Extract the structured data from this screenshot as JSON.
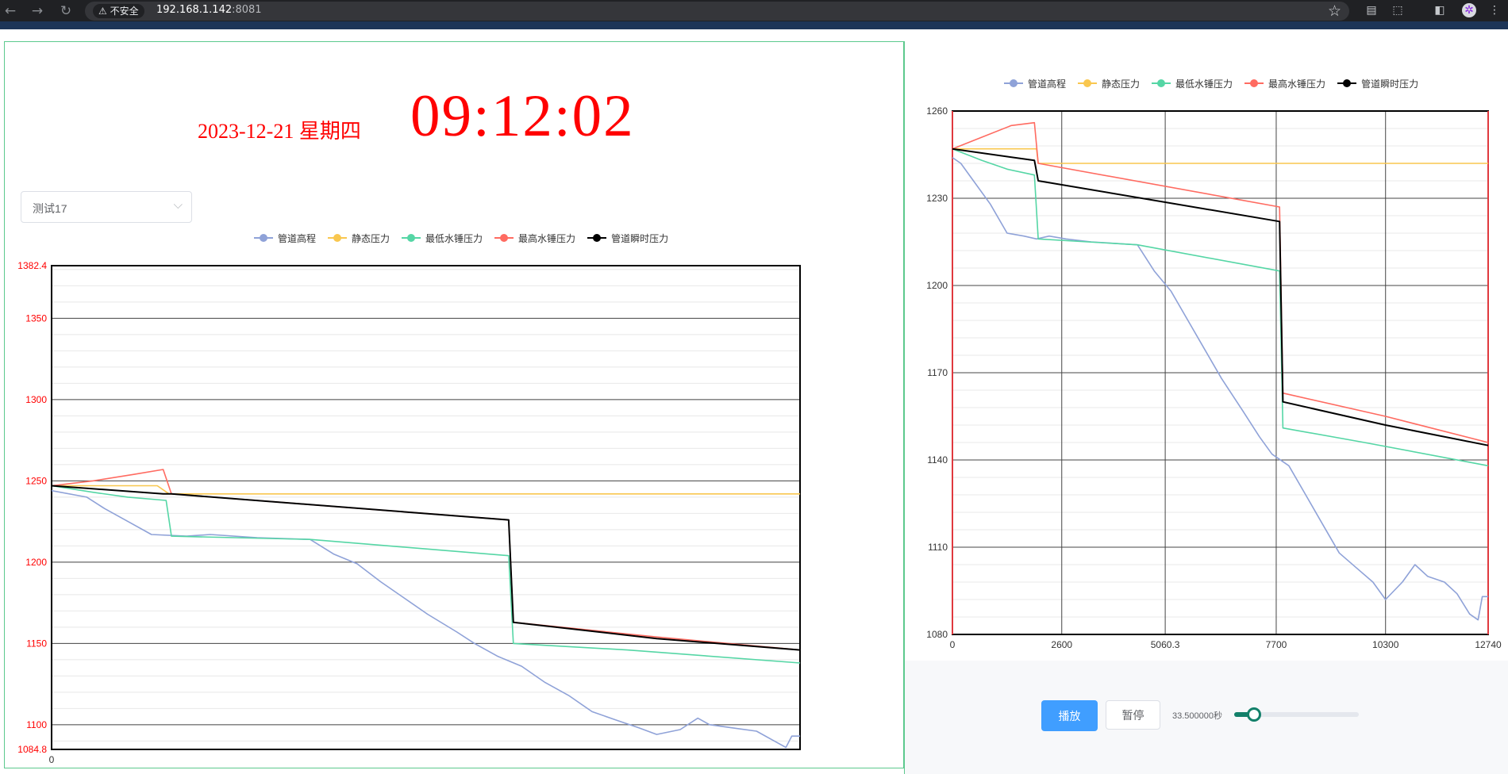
{
  "browser": {
    "security_label": "不安全",
    "url_host": "192.168.1.142",
    "url_port": ":8081"
  },
  "header": {
    "date": "2023-12-21 星期四",
    "time": "09:12:02"
  },
  "select": {
    "value": "测试17"
  },
  "legend": [
    {
      "name": "管道高程",
      "color": "#8fa2d8"
    },
    {
      "name": "静态压力",
      "color": "#f9c74f"
    },
    {
      "name": "最低水锤压力",
      "color": "#55d6a5"
    },
    {
      "name": "最高水锤压力",
      "color": "#ff6b61"
    },
    {
      "name": "管道瞬时压力",
      "color": "#000000"
    }
  ],
  "controls": {
    "play": "播放",
    "pause": "暂停",
    "speed": "33.500000秒",
    "progress": 0.16
  },
  "chart_data": [
    {
      "type": "line",
      "title": "",
      "xlabel": "",
      "ylabel": "",
      "xlim": [
        0,
        12740
      ],
      "ylim": [
        1084.8,
        1382.4
      ],
      "yticks": [
        "1382.4",
        "1350",
        "1300",
        "1250",
        "1200",
        "1150",
        "1100",
        "1084.8"
      ],
      "xticks": [
        "0"
      ],
      "grid": true,
      "legend_position": "top",
      "series": [
        {
          "name": "管道高程",
          "color": "#8fa2d8",
          "values": [
            [
              0,
              1244
            ],
            [
              600,
              1240
            ],
            [
              900,
              1233
            ],
            [
              1300,
              1225
            ],
            [
              1700,
              1217
            ],
            [
              2300,
              1216
            ],
            [
              2700,
              1217
            ],
            [
              3500,
              1215
            ],
            [
              4400,
              1214
            ],
            [
              4800,
              1205
            ],
            [
              5200,
              1199
            ],
            [
              5600,
              1188
            ],
            [
              6000,
              1178
            ],
            [
              6400,
              1168
            ],
            [
              6900,
              1157
            ],
            [
              7200,
              1150
            ],
            [
              7600,
              1142
            ],
            [
              8000,
              1136
            ],
            [
              8400,
              1126
            ],
            [
              8800,
              1118
            ],
            [
              9200,
              1108
            ],
            [
              9600,
              1103
            ],
            [
              10000,
              1098
            ],
            [
              10300,
              1094
            ],
            [
              10700,
              1097
            ],
            [
              11000,
              1104
            ],
            [
              11200,
              1100
            ],
            [
              11600,
              1098
            ],
            [
              12000,
              1096
            ],
            [
              12300,
              1090
            ],
            [
              12500,
              1086
            ],
            [
              12600,
              1093
            ],
            [
              12740,
              1093
            ]
          ]
        },
        {
          "name": "静态压力",
          "color": "#f9c74f",
          "values": [
            [
              0,
              1247
            ],
            [
              1800,
              1247
            ],
            [
              2000,
              1242
            ],
            [
              12740,
              1242
            ]
          ]
        },
        {
          "name": "最低水锤压力",
          "color": "#55d6a5",
          "values": [
            [
              0,
              1247
            ],
            [
              700,
              1243
            ],
            [
              1300,
              1240
            ],
            [
              1950,
              1238
            ],
            [
              2040,
              1216
            ],
            [
              4400,
              1214
            ],
            [
              7780,
              1204
            ],
            [
              7860,
              1150
            ],
            [
              9800,
              1146
            ],
            [
              12740,
              1138
            ]
          ]
        },
        {
          "name": "最高水锤压力",
          "color": "#ff6b61",
          "values": [
            [
              0,
              1247
            ],
            [
              700,
              1250
            ],
            [
              1400,
              1254
            ],
            [
              1900,
              1257
            ],
            [
              2040,
              1242
            ],
            [
              7780,
              1226
            ],
            [
              7860,
              1163
            ],
            [
              10300,
              1154
            ],
            [
              12740,
              1146
            ]
          ]
        },
        {
          "name": "管道瞬时压力",
          "color": "#000000",
          "values": [
            [
              0,
              1247
            ],
            [
              1900,
              1242
            ],
            [
              2040,
              1242
            ],
            [
              7780,
              1226
            ],
            [
              7860,
              1163
            ],
            [
              10300,
              1153
            ],
            [
              12740,
              1146
            ]
          ]
        }
      ]
    },
    {
      "type": "line",
      "title": "",
      "xlabel": "",
      "ylabel": "",
      "xlim": [
        0,
        12740
      ],
      "ylim": [
        1080,
        1260
      ],
      "xticks": [
        "0",
        "2600",
        "5060.3",
        "7700",
        "10300",
        "12740"
      ],
      "yticks": [
        "1260",
        "1230",
        "1200",
        "1170",
        "1140",
        "1110",
        "1080"
      ],
      "grid": true,
      "legend_position": "top",
      "series": [
        {
          "name": "管道高程",
          "color": "#8fa2d8",
          "values": [
            [
              0,
              1244
            ],
            [
              200,
              1242
            ],
            [
              500,
              1236
            ],
            [
              900,
              1228
            ],
            [
              1300,
              1218
            ],
            [
              1700,
              1217
            ],
            [
              2000,
              1216
            ],
            [
              2300,
              1217
            ],
            [
              2700,
              1216
            ],
            [
              3300,
              1215
            ],
            [
              4400,
              1214
            ],
            [
              4800,
              1205
            ],
            [
              5200,
              1198
            ],
            [
              5600,
              1188
            ],
            [
              6000,
              1178
            ],
            [
              6400,
              1168
            ],
            [
              6900,
              1157
            ],
            [
              7300,
              1148
            ],
            [
              7600,
              1142
            ],
            [
              8000,
              1138
            ],
            [
              8400,
              1128
            ],
            [
              8800,
              1118
            ],
            [
              9200,
              1108
            ],
            [
              9600,
              1103
            ],
            [
              10000,
              1098
            ],
            [
              10300,
              1092
            ],
            [
              10700,
              1098
            ],
            [
              11000,
              1104
            ],
            [
              11300,
              1100
            ],
            [
              11700,
              1098
            ],
            [
              12000,
              1094
            ],
            [
              12300,
              1087
            ],
            [
              12500,
              1085
            ],
            [
              12600,
              1093
            ],
            [
              12740,
              1093
            ]
          ]
        },
        {
          "name": "静态压力",
          "color": "#f9c74f",
          "values": [
            [
              0,
              1247
            ],
            [
              2000,
              1247
            ],
            [
              2040,
              1242
            ],
            [
              12740,
              1242
            ]
          ]
        },
        {
          "name": "最低水锤压力",
          "color": "#55d6a5",
          "values": [
            [
              0,
              1247
            ],
            [
              700,
              1243
            ],
            [
              1300,
              1240
            ],
            [
              1950,
              1238
            ],
            [
              2040,
              1216
            ],
            [
              4400,
              1214
            ],
            [
              7780,
              1205
            ],
            [
              7860,
              1151
            ],
            [
              9800,
              1146
            ],
            [
              12740,
              1138
            ]
          ]
        },
        {
          "name": "最高水锤压力",
          "color": "#ff6b61",
          "values": [
            [
              0,
              1247
            ],
            [
              700,
              1251
            ],
            [
              1400,
              1255
            ],
            [
              1950,
              1256
            ],
            [
              2040,
              1242
            ],
            [
              7780,
              1227
            ],
            [
              7860,
              1163
            ],
            [
              10300,
              1155
            ],
            [
              12740,
              1146
            ]
          ]
        },
        {
          "name": "管道瞬时压力",
          "color": "#000000",
          "values": [
            [
              0,
              1247
            ],
            [
              1950,
              1243
            ],
            [
              2040,
              1236
            ],
            [
              7780,
              1222
            ],
            [
              7860,
              1160
            ],
            [
              10300,
              1152
            ],
            [
              12740,
              1145
            ]
          ]
        }
      ]
    }
  ]
}
